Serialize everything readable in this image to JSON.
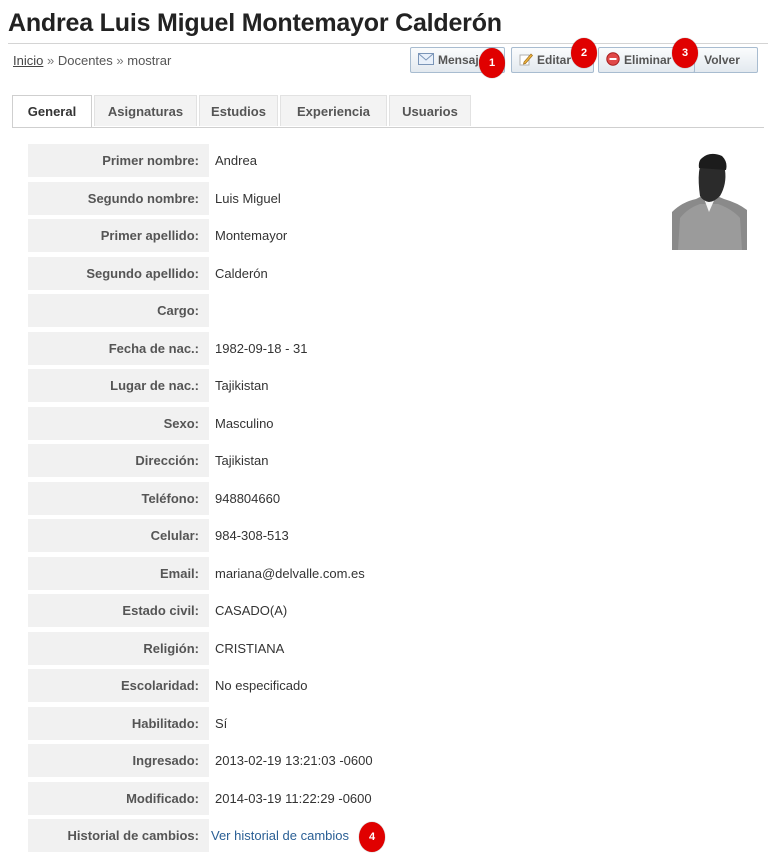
{
  "header": {
    "title": "Andrea Luis Miguel Montemayor Calderón"
  },
  "breadcrumb": {
    "home": "Inicio",
    "sep1": "»",
    "section": "Docentes",
    "sep2": "»",
    "current": "mostrar"
  },
  "toolbar": {
    "message_label": "Mensaje",
    "edit_label": "Editar",
    "delete_label": "Eliminar",
    "back_label": "Volver"
  },
  "markers": [
    "1",
    "2",
    "3",
    "4"
  ],
  "tabs": [
    "General",
    "Asignaturas",
    "Estudios",
    "Experiencia",
    "Usuarios"
  ],
  "fields": [
    {
      "label": "Primer nombre:",
      "value": "Andrea"
    },
    {
      "label": "Segundo nombre:",
      "value": "Luis Miguel"
    },
    {
      "label": "Primer apellido:",
      "value": "Montemayor"
    },
    {
      "label": "Segundo apellido:",
      "value": "Calderón"
    },
    {
      "label": "Cargo:",
      "value": ""
    },
    {
      "label": "Fecha de nac.:",
      "value": "1982-09-18 - 31"
    },
    {
      "label": "Lugar de nac.:",
      "value": "Tajikistan"
    },
    {
      "label": "Sexo:",
      "value": "Masculino"
    },
    {
      "label": "Dirección:",
      "value": "Tajikistan"
    },
    {
      "label": "Teléfono:",
      "value": "948804660"
    },
    {
      "label": "Celular:",
      "value": "984-308-513"
    },
    {
      "label": "Email:",
      "value": "mariana@delvalle.com.es"
    },
    {
      "label": "Estado civil:",
      "value": "CASADO(A)"
    },
    {
      "label": "Religión:",
      "value": "CRISTIANA"
    },
    {
      "label": "Escolaridad:",
      "value": "No especificado"
    },
    {
      "label": "Habilitado:",
      "value": "Sí"
    },
    {
      "label": "Ingresado:",
      "value": "2013-02-19 13:21:03 -0600"
    },
    {
      "label": "Modificado:",
      "value": "2014-03-19 11:22:29 -0600"
    },
    {
      "label": "Historial de cambios:",
      "value": "Ver historial de cambios"
    }
  ],
  "colors": {
    "accent_link": "#2a5f95",
    "marker": "#e00000",
    "label_bg": "#f1f1f1"
  }
}
